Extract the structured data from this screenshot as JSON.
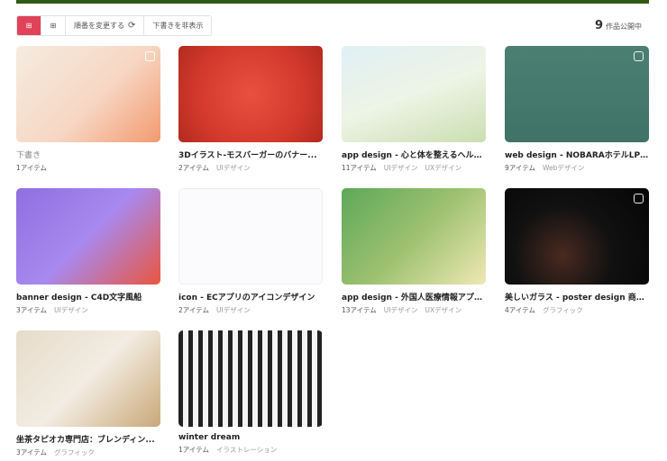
{
  "toolbar": {
    "sort_label": "順番を変更する",
    "hide_drafts_label": "下書きを非表示"
  },
  "published": {
    "count": "9",
    "label": "作品公開中"
  },
  "cards": [
    {
      "title": "下書き",
      "items": "1アイテム",
      "tags": [],
      "draft": true,
      "bg": "linear-gradient(135deg,#f4ece0 0%,#f7d7c4 55%,#f29a6f 100%)",
      "badge": true
    },
    {
      "title": "3Dイラスト-モスバーガーのバナー...",
      "items": "2アイテム",
      "tags": [
        "UIデザイン"
      ],
      "bg": "radial-gradient(circle at 50% 50%,#e9503f 0%,#d43a2c 60%,#b22a20 100%)"
    },
    {
      "title": "app design - 心と体を整えるヘルス...",
      "items": "11アイテム",
      "tags": [
        "UIデザイン",
        "UXデザイン"
      ],
      "bg": "linear-gradient(160deg,#dff0f4 0%,#eef4e6 50%,#c9dfb0 100%)"
    },
    {
      "title": "web design - NOBARAホテルLP制作",
      "items": "9アイテム",
      "tags": [
        "Webデザイン"
      ],
      "bg": "linear-gradient(180deg,#4b7f72,#3f7367)",
      "badge": true
    },
    {
      "title": "banner design - C4D文字風船",
      "items": "3アイテム",
      "tags": [
        "UIデザイン"
      ],
      "bg": "linear-gradient(135deg,#8f6fe0 0%,#a889ef 50%,#e9563f 100%)"
    },
    {
      "title": "icon - ECアプリのアイコンデザイン",
      "items": "2アイテム",
      "tags": [
        "UIデザイン"
      ],
      "bg": "#fbfbfd"
    },
    {
      "title": "app design - 外国人医療情報アプリ...",
      "items": "13アイテム",
      "tags": [
        "UIデザイン",
        "UXデザイン"
      ],
      "bg": "linear-gradient(135deg,#5ea85a 0%,#9cc16f 50%,#efe8b4 100%)"
    },
    {
      "title": "美しいガラス - poster design 商品...",
      "items": "4アイテム",
      "tags": [
        "グラフィック"
      ],
      "bg": "radial-gradient(circle at 40% 70%,#4a2a20 0%,#111 45%,#050505 100%)",
      "badge": true
    },
    {
      "title": "坐茶タピオカ専門店：ブレンディン...",
      "items": "3アイテム",
      "tags": [
        "グラフィック"
      ],
      "bg": "linear-gradient(135deg,#e6dccb 0%,#f3ece2 50%,#c9a878 100%)"
    },
    {
      "title": "winter dream",
      "items": "1アイテム",
      "tags": [
        "イラストレーション"
      ],
      "bg": "repeating-linear-gradient(90deg,#222 0 5px,#f4f4f4 5px 11px)"
    }
  ]
}
